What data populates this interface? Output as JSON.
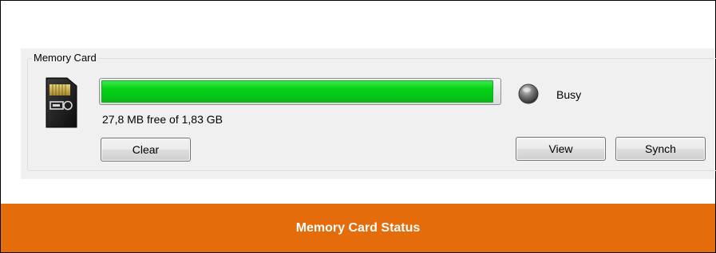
{
  "memory_card": {
    "group_title": "Memory Card",
    "usage_fraction": 0.985,
    "free_text": "27,8 MB free of 1,83 GB",
    "status_label": "Busy",
    "buttons": {
      "clear": "Clear",
      "view": "View",
      "synch": "Synch"
    }
  },
  "caption": "Memory Card Status",
  "colors": {
    "progress_green": "#05c616",
    "caption_bg": "#e46c0a",
    "caption_text": "#ffffff",
    "panel_bg": "#f0f0f0"
  },
  "icons": {
    "card": "memory-card-icon",
    "status": "busy-indicator-icon"
  }
}
